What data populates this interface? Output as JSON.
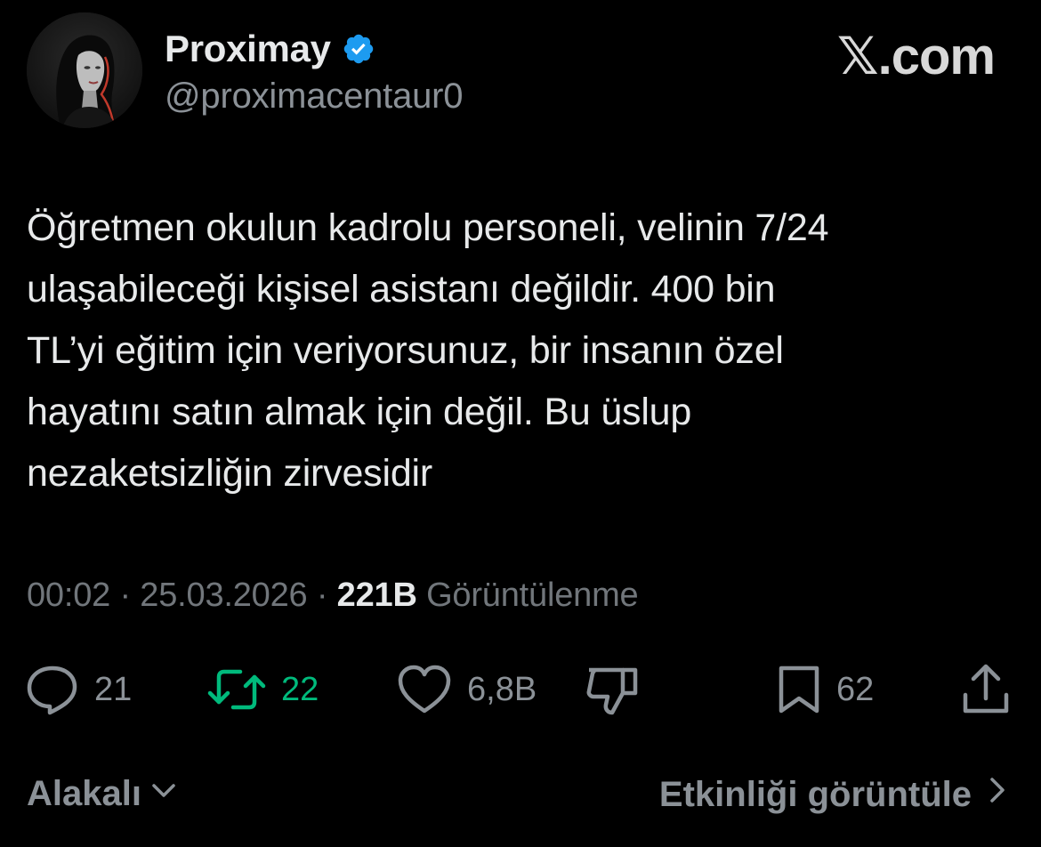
{
  "header": {
    "display_name": "Proximay",
    "handle": "@proximacentaur0",
    "verified": true,
    "verified_color": "#1d9bf0",
    "watermark": "𝕏.com"
  },
  "tweet": {
    "lines": [
      "Öğretmen okulun kadrolu personeli, velinin 7/24",
      "ulaşabileceği kişisel asistanı değildir. 400 bin",
      "TL’yi eğitim için veriyorsunuz, bir insanın özel",
      "hayatını satın almak için değil. Bu üslup",
      "nezaketsizliğin zirvesidir"
    ]
  },
  "meta": {
    "time": "00:02",
    "separator": "·",
    "date": "25.03.2026",
    "views_count": "221B",
    "views_label": "Görüntülenme"
  },
  "actions": {
    "reply": {
      "icon": "reply-icon",
      "count": "21"
    },
    "retweet": {
      "icon": "retweet-icon",
      "count": "22",
      "color": "#00ba7c"
    },
    "like": {
      "icon": "heart-icon",
      "count": "6,8B"
    },
    "dislike": {
      "icon": "thumbs-down-icon"
    },
    "bookmark": {
      "icon": "bookmark-icon",
      "count": "62"
    },
    "share": {
      "icon": "share-icon"
    }
  },
  "footer": {
    "sort_label": "Alakalı",
    "activity_label": "Etkinliği görüntüle"
  },
  "colors": {
    "background": "#000000",
    "text": "#e7e9ea",
    "muted": "#71767b",
    "accent_green": "#00ba7c"
  }
}
